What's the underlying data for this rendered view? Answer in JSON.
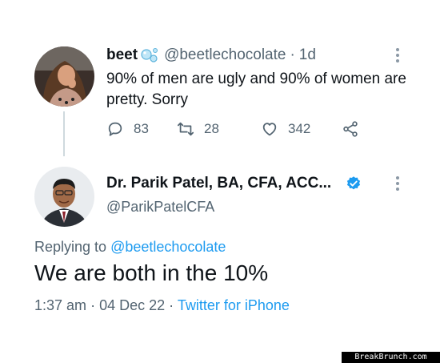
{
  "tweet1": {
    "author_name": "beet",
    "handle": "@beetlechocolate",
    "separator": "·",
    "time": "1d",
    "text": "90% of men are ugly and 90% of women are pretty. Sorry",
    "reply_count": "83",
    "retweet_count": "28",
    "like_count": "342",
    "icons": [
      "bubbles-emoji-icon",
      "reply-icon",
      "retweet-icon",
      "like-icon",
      "share-icon",
      "more-options-icon"
    ]
  },
  "tweet2": {
    "author_name": "Dr. Parik Patel, BA, CFA, ACC...",
    "handle": "@ParikPatelCFA",
    "replying_prefix": "Replying to",
    "replying_mention": "@beetlechocolate",
    "text": "We are both in the 10%",
    "time": "1:37 am",
    "separator1": "·",
    "date": "04 Dec 22",
    "separator2": "·",
    "source": "Twitter for iPhone",
    "icons": [
      "verified-badge-icon",
      "more-options-icon"
    ]
  },
  "watermark": "BreakBrunch.com",
  "colors": {
    "text": "#0f1419",
    "secondary": "#536471",
    "link": "#1d9bf0",
    "verified": "#1d9bf0",
    "thread_line": "#cfd9de"
  }
}
